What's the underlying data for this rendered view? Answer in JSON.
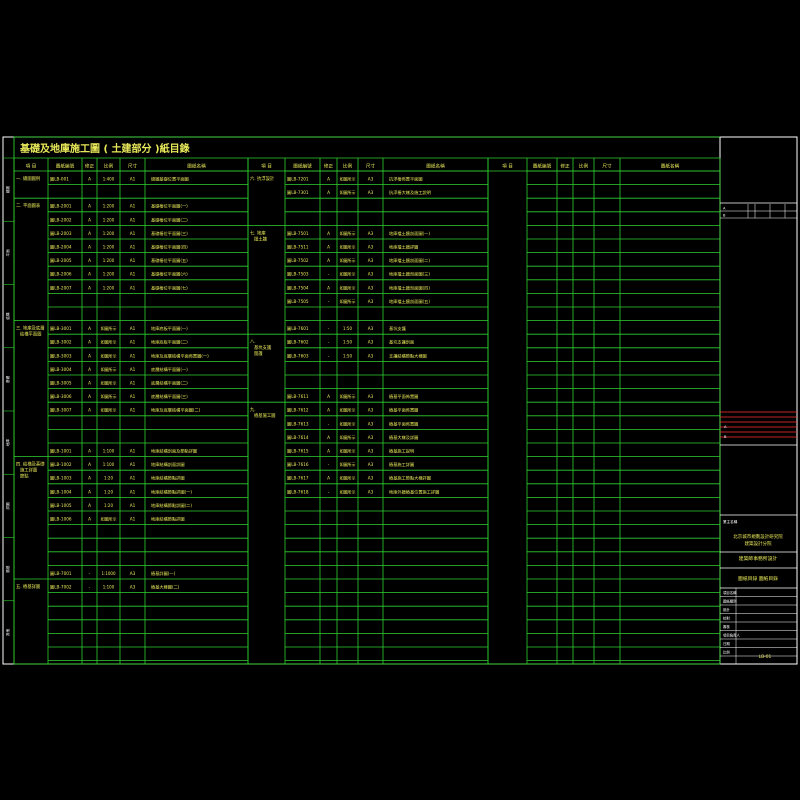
{
  "title": "基礎及地庫施工圖 ( 土建部分 )紙目錄",
  "headers": [
    "項 目",
    "圖紙編號",
    "修正",
    "比例",
    "尺寸",
    "圖紙名稱"
  ],
  "columns": [
    {
      "sections": [
        {
          "label": "一. 總圖圖例",
          "row": 0
        },
        {
          "label": "二. 平面圖表",
          "row": 2
        },
        {
          "label": "三. 地庫及底層",
          "row": 11,
          "label2": "結構平面圖"
        },
        {
          "label": "四. 結構及基礎",
          "row": 21,
          "label2": "施工詳圖",
          "label3": "節點"
        },
        {
          "label": "五. 樁基詳圖",
          "row": 30
        }
      ],
      "rows": [
        {
          "r": 0,
          "no": "圖LB-001",
          "rev": "A",
          "scale": "1:400",
          "size": "A1",
          "name": "總圖基礎位置平面圖"
        },
        {
          "r": 2,
          "no": "圖LB-2001",
          "rev": "A",
          "scale": "1:200",
          "size": "A1",
          "name": "基礎樁位平面圖(一)"
        },
        {
          "r": 3,
          "no": "圖LB-2002",
          "rev": "A",
          "scale": "1:200",
          "size": "A1",
          "name": "基礎樁位平面圖(二)"
        },
        {
          "r": 4,
          "no": "圖LB-2003",
          "rev": "A",
          "scale": "1:200",
          "size": "A1",
          "name": "基礎樁位平面圖(三)"
        },
        {
          "r": 5,
          "no": "圖LB-2004",
          "rev": "A",
          "scale": "1:200",
          "size": "A1",
          "name": "基礎樁位平面圖(四)"
        },
        {
          "r": 6,
          "no": "圖LB-2005",
          "rev": "A",
          "scale": "1:200",
          "size": "A1",
          "name": "基礎樁位平面圖(五)"
        },
        {
          "r": 7,
          "no": "圖LB-2006",
          "rev": "A",
          "scale": "1:200",
          "size": "A1",
          "name": "基礎樁位平面圖(六)"
        },
        {
          "r": 8,
          "no": "圖LB-2007",
          "rev": "A",
          "scale": "1:200",
          "size": "A1",
          "name": "基礎樁位平面圖(七)"
        },
        {
          "r": 11,
          "no": "圖LB-3001",
          "rev": "A",
          "scale": "如圖所示",
          "size": "A1",
          "name": "地庫底板平面圖(一)"
        },
        {
          "r": 12,
          "no": "圖LB-3002",
          "rev": "A",
          "scale": "如圖所示",
          "size": "A1",
          "name": "地庫底板平面圖(二)"
        },
        {
          "r": 13,
          "no": "圖LB-3003",
          "rev": "A",
          "scale": "如圖所示",
          "size": "A1",
          "name": "地庫及底層結構平面佈置圖(一)"
        },
        {
          "r": 14,
          "no": "圖LB-3004",
          "rev": "A",
          "scale": "如圖所示",
          "size": "A1",
          "name": "底層結構平面圖(一)"
        },
        {
          "r": 15,
          "no": "圖LB-3005",
          "rev": "A",
          "scale": "如圖所示",
          "size": "A1",
          "name": "底層結構平面圖(二)"
        },
        {
          "r": 16,
          "no": "圖LB-3006",
          "rev": "A",
          "scale": "如圖所示",
          "size": "A1",
          "name": "底層結構平面圖(三)"
        },
        {
          "r": 17,
          "no": "圖LB-3007",
          "rev": "A",
          "scale": "如圖所示",
          "size": "A1",
          "name": "地庫及底層結構平面圖(二)"
        },
        {
          "r": 20,
          "no": "圖LB-1001",
          "rev": "A",
          "scale": "1:100",
          "size": "A1",
          "name": "地庫結構剖面及節點詳圖"
        },
        {
          "r": 21,
          "no": "圖LB-1002",
          "rev": "A",
          "scale": "1:100",
          "size": "A1",
          "name": "地庫結構剖面詳圖"
        },
        {
          "r": 22,
          "no": "圖LB-1003",
          "rev": "A",
          "scale": "1:20",
          "size": "A1",
          "name": "地庫結構節點詳圖"
        },
        {
          "r": 23,
          "no": "圖LB-1004",
          "rev": "A",
          "scale": "1:20",
          "size": "A1",
          "name": "地庫結構節點詳圖(一)"
        },
        {
          "r": 24,
          "no": "圖LB-1005",
          "rev": "A",
          "scale": "1:20",
          "size": "A1",
          "name": "地庫結構節點詳圖(二)"
        },
        {
          "r": 25,
          "no": "圖LB-1006",
          "rev": "A",
          "scale": "如圖所示",
          "size": "A1",
          "name": "地庫結構節點詳圖"
        },
        {
          "r": 29,
          "no": "圖LB-7001",
          "rev": "-",
          "scale": "1:1000",
          "size": "A3",
          "name": "樁基詳圖(一)"
        },
        {
          "r": 30,
          "no": "圖LB-7002",
          "rev": "-",
          "scale": "1:100",
          "size": "A3",
          "name": "樁基大樣圖(二)"
        }
      ]
    },
    {
      "sections": [
        {
          "label": "六. 抗浮設計",
          "row": 0
        },
        {
          "label": "七. 地庫",
          "row": 4,
          "label2": "擋土牆"
        },
        {
          "label": "八.",
          "row": 12,
          "label2": "基坑支護",
          "label3": "圍護"
        },
        {
          "label": "九.",
          "row": 17,
          "label2": "樁基施工圖"
        }
      ],
      "rows": [
        {
          "r": 0,
          "no": "圖LB-7201",
          "rev": "A",
          "scale": "如圖所示",
          "size": "A3",
          "name": "抗浮樁佈置平面圖"
        },
        {
          "r": 1,
          "no": "圖LB-7301",
          "rev": "A",
          "scale": "如圖所示",
          "size": "A3",
          "name": "抗浮樁大樣及施工說明"
        },
        {
          "r": 4,
          "no": "圖LB-7501",
          "rev": "A",
          "scale": "如圖所示",
          "size": "A3",
          "name": "地庫擋土牆剖面圖(一)"
        },
        {
          "r": 5,
          "no": "圖LB-7511",
          "rev": "A",
          "scale": "如圖所示",
          "size": "A3",
          "name": "地庫擋土牆詳圖"
        },
        {
          "r": 6,
          "no": "圖LB-7502",
          "rev": "A",
          "scale": "如圖所示",
          "size": "A3",
          "name": "地庫擋土牆剖面圖(二)"
        },
        {
          "r": 7,
          "no": "圖LB-7503",
          "rev": "-",
          "scale": "如圖所示",
          "size": "A3",
          "name": "地庫擋土牆剖面圖(三)"
        },
        {
          "r": 8,
          "no": "圖LB-7504",
          "rev": "A",
          "scale": "如圖所示",
          "size": "A3",
          "name": "地庫擋土牆剖面圖(四)"
        },
        {
          "r": 9,
          "no": "圖LB-7505",
          "rev": "-",
          "scale": "如圖所示",
          "size": "A3",
          "name": "地庫擋土牆剖面圖(五)"
        },
        {
          "r": 11,
          "no": "圖LB-7601",
          "rev": "-",
          "scale": "1:50",
          "size": "A3",
          "name": "基坑支護"
        },
        {
          "r": 12,
          "no": "圖LB-7602",
          "rev": "-",
          "scale": "1:50",
          "size": "A3",
          "name": "基坑支護剖面"
        },
        {
          "r": 13,
          "no": "圖LB-7603",
          "rev": "-",
          "scale": "1:50",
          "size": "A3",
          "name": "支護結構節點大樣圖"
        },
        {
          "r": 16,
          "no": "圖LB-7611",
          "rev": "A",
          "scale": "如圖所示",
          "size": "A3",
          "name": "樁基平面佈置圖"
        },
        {
          "r": 17,
          "no": "圖LB-7612",
          "rev": "A",
          "scale": "如圖所示",
          "size": "A3",
          "name": "樁基平面佈置圖"
        },
        {
          "r": 18,
          "no": "圖LB-7613",
          "rev": "-",
          "scale": "如圖所示",
          "size": "A3",
          "name": "樁基平面佈置圖"
        },
        {
          "r": 19,
          "no": "圖LB-7614",
          "rev": "A",
          "scale": "如圖所示",
          "size": "A3",
          "name": "樁基大樣及詳圖"
        },
        {
          "r": 20,
          "no": "圖LB-7615",
          "rev": "A",
          "scale": "如圖所示",
          "size": "A3",
          "name": "樁基施工說明"
        },
        {
          "r": 21,
          "no": "圖LB-7616",
          "rev": "-",
          "scale": "如圖所示",
          "size": "A3",
          "name": "樁基施工詳圖"
        },
        {
          "r": 22,
          "no": "圖LB-7617",
          "rev": "A",
          "scale": "如圖所示",
          "size": "A3",
          "name": "樁基施工節點大樣詳圖"
        },
        {
          "r": 23,
          "no": "圖LB-7618",
          "rev": "-",
          "scale": "如圖所示",
          "size": "A3",
          "name": "地庫外牆樁基位置施工詳圖"
        }
      ]
    },
    {
      "sections": [],
      "rows": []
    }
  ],
  "title_block": {
    "rev_rows": [
      [
        "A",
        "",
        ""
      ],
      [
        "B",
        "",
        ""
      ]
    ],
    "client_lines": [
      "業主名稱",
      "北京城市規劃設計研究院",
      "建築設計分院"
    ],
    "firm_line": "建築師事務所設計",
    "drawing_title": "圖紙目錄 圖紙目錄",
    "info_rows": [
      "項目名稱",
      "圖紙類別",
      "設計",
      "校對",
      "審核",
      "項目負責人",
      "日期",
      "比例"
    ],
    "sheet_no": "LB-01",
    "side_labels": [
      "總圖",
      "平面",
      "結構",
      "基礎",
      "地庫",
      "詳圖",
      "樁基",
      "其他"
    ]
  },
  "colors": {
    "line": "#2fd12f",
    "text": "#e8e85a",
    "text_alt": "#ffffff",
    "accent": "#ff3030",
    "bg": "#000000"
  }
}
